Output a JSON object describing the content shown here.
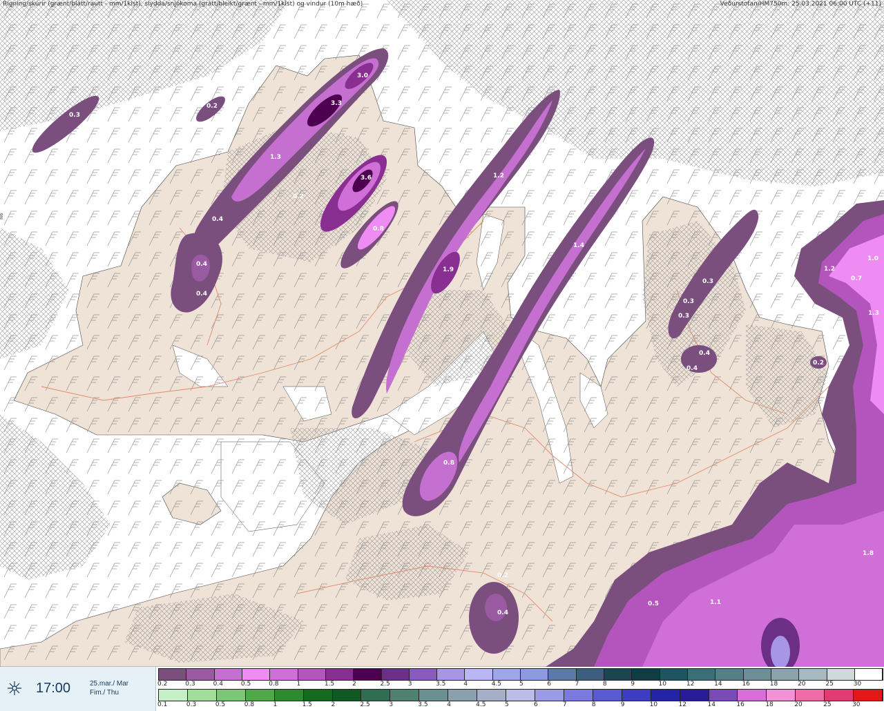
{
  "header": {
    "left_text": "Rigning/skúrir (grænt/blátt/rautt - mm/1klst), slydda/snjókoma (grátt/bleikt/grænt - mm/1klst) og vindur (10m hæð)",
    "right_text": "Veðurstofan/HM750m: 25.03.2021 06:00 UTC (+11)"
  },
  "time": {
    "icon": "wind-flag-icon",
    "hour": "17:00",
    "date_line1": "25.mar./ Mar",
    "date_line2": "Fim./ Thu"
  },
  "precip_labels": [
    {
      "value": "0.3"
    },
    {
      "value": "0.2"
    },
    {
      "value": "3.0"
    },
    {
      "value": "3.3"
    },
    {
      "value": "1.3"
    },
    {
      "value": "3.6"
    },
    {
      "value": "0.2"
    },
    {
      "value": "0.8"
    },
    {
      "value": "0.4"
    },
    {
      "value": "0.4"
    },
    {
      "value": "0.4"
    },
    {
      "value": "1.2"
    },
    {
      "value": "1.9"
    },
    {
      "value": "1.4"
    },
    {
      "value": "0.8"
    },
    {
      "value": "0.3"
    },
    {
      "value": "0.3"
    },
    {
      "value": "0.3"
    },
    {
      "value": "0.4"
    },
    {
      "value": "0.4"
    },
    {
      "value": "0.2"
    },
    {
      "value": "1.2"
    },
    {
      "value": "0.7"
    },
    {
      "value": "1.0"
    },
    {
      "value": "1.3"
    },
    {
      "value": "1.8"
    },
    {
      "value": "0.5"
    },
    {
      "value": "1.1"
    },
    {
      "value": "0.2"
    },
    {
      "value": "0.4"
    }
  ],
  "legend_snow": {
    "ticks": [
      "0.2",
      "0.3",
      "0.4",
      "0.5",
      "0.8",
      "1",
      "1.5",
      "2",
      "2.5",
      "3",
      "3.5",
      "4",
      "4.5",
      "5",
      "6",
      "7",
      "8",
      "9",
      "10",
      "12",
      "14",
      "16",
      "18",
      "20",
      "25",
      "30"
    ],
    "colors": [
      "#7a4f7e",
      "#9a5aa2",
      "#c56fd0",
      "#ef8cf3",
      "#d16fd9",
      "#b455be",
      "#8a2f92",
      "#4e0050",
      "#6b2f86",
      "#8a5ac0",
      "#a796e6",
      "#bab6f5",
      "#9ea6e8",
      "#8c9be0",
      "#5c7aa8",
      "#3d5e80",
      "#1b4550",
      "#0f3c45",
      "#1f5560",
      "#3b6e78",
      "#557f88",
      "#6e8f98",
      "#8aa2ab",
      "#a6b8c0",
      "#d0d8dc",
      "#ffffff"
    ]
  },
  "legend_rain": {
    "ticks": [
      "0.1",
      "0.3",
      "0.5",
      "0.8",
      "1",
      "1.5",
      "2",
      "2.5",
      "3",
      "3.5",
      "4",
      "4.5",
      "5",
      "6",
      "7",
      "8",
      "9",
      "10",
      "12",
      "14",
      "16",
      "18",
      "20",
      "25",
      "30"
    ],
    "colors": [
      "#c8f0c8",
      "#a2dd9c",
      "#7cc776",
      "#4fa84a",
      "#2e8a2e",
      "#146a1e",
      "#0e5a22",
      "#2f6e52",
      "#4f8070",
      "#6a9090",
      "#8aa0ae",
      "#a7aec8",
      "#bdbbe8",
      "#9a9ae6",
      "#7a7ae0",
      "#5a5ad4",
      "#3b3bc4",
      "#2323a8",
      "#2a1a9a",
      "#7a4ab8",
      "#d86ed8",
      "#f391d6",
      "#f06aa8",
      "#e43a72",
      "#e01818"
    ]
  }
}
